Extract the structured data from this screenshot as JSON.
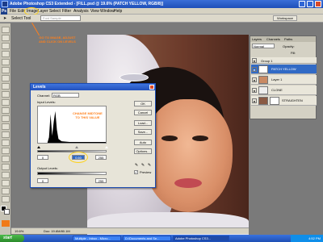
{
  "window": {
    "title": "Adobe Photoshop CS3 Extended - [FILL.psd @ 19.6% (PATCH YELLOW, RGB/8)]"
  },
  "menu": {
    "items": [
      "File",
      "Edit",
      "Image",
      "Layer",
      "Select",
      "Filter",
      "Analysis",
      "View",
      "Window",
      "Help"
    ]
  },
  "options_bar": {
    "tool_label": "Select Tool",
    "field_placeholder": "Font Sample",
    "workspace_label": "Workspace"
  },
  "annotations": {
    "menu_tip": "GO TO IMAGE, ADJUST\nAND CLICK ON LEVELS",
    "levels_tip": "CHANGE MIDTONE\nTO THIS VALUE",
    "accent_color": "#ff7f1a",
    "circle_color": "#ffd21a"
  },
  "levels_dialog": {
    "title": "Levels",
    "channel_label": "Channel:",
    "channel_value": "RGB",
    "input_levels_label": "Input Levels:",
    "input_black": "0",
    "input_mid": "0.60",
    "input_white": "255",
    "output_levels_label": "Output Levels:",
    "output_black": "0",
    "output_white": "255",
    "buttons": [
      "OK",
      "Cancel",
      "Load...",
      "Save...",
      "Auto",
      "Options..."
    ],
    "preview_label": "Preview",
    "preview_checked": "✓"
  },
  "layers_panel": {
    "tabs": [
      "Layers",
      "Channels",
      "Paths"
    ],
    "blend_mode": "Normal",
    "opacity_label": "Opacity:",
    "fill_label": "Fill:",
    "group_name": "Group 1",
    "layers": [
      {
        "name": "PATCH YELLOW",
        "selected": true,
        "thumb": "#ffffff"
      },
      {
        "name": "Layer 1",
        "selected": false,
        "thumb": "#c98a64"
      },
      {
        "name": "CLONE",
        "selected": false,
        "thumb": "#eeeeee"
      },
      {
        "name": "STRAIGHTEN",
        "selected": false,
        "thumb": "#8a5a44"
      }
    ]
  },
  "status_bar": {
    "zoom": "19.6%",
    "doc": "Doc: 19.6M/80.1M"
  },
  "taskbar": {
    "start": "start",
    "tasks": [
      "Multiple - Inbox - Micro...",
      "D:\\Documents and Se...",
      "Adobe Photoshop CS3..."
    ],
    "clock": "4:52 PM"
  }
}
